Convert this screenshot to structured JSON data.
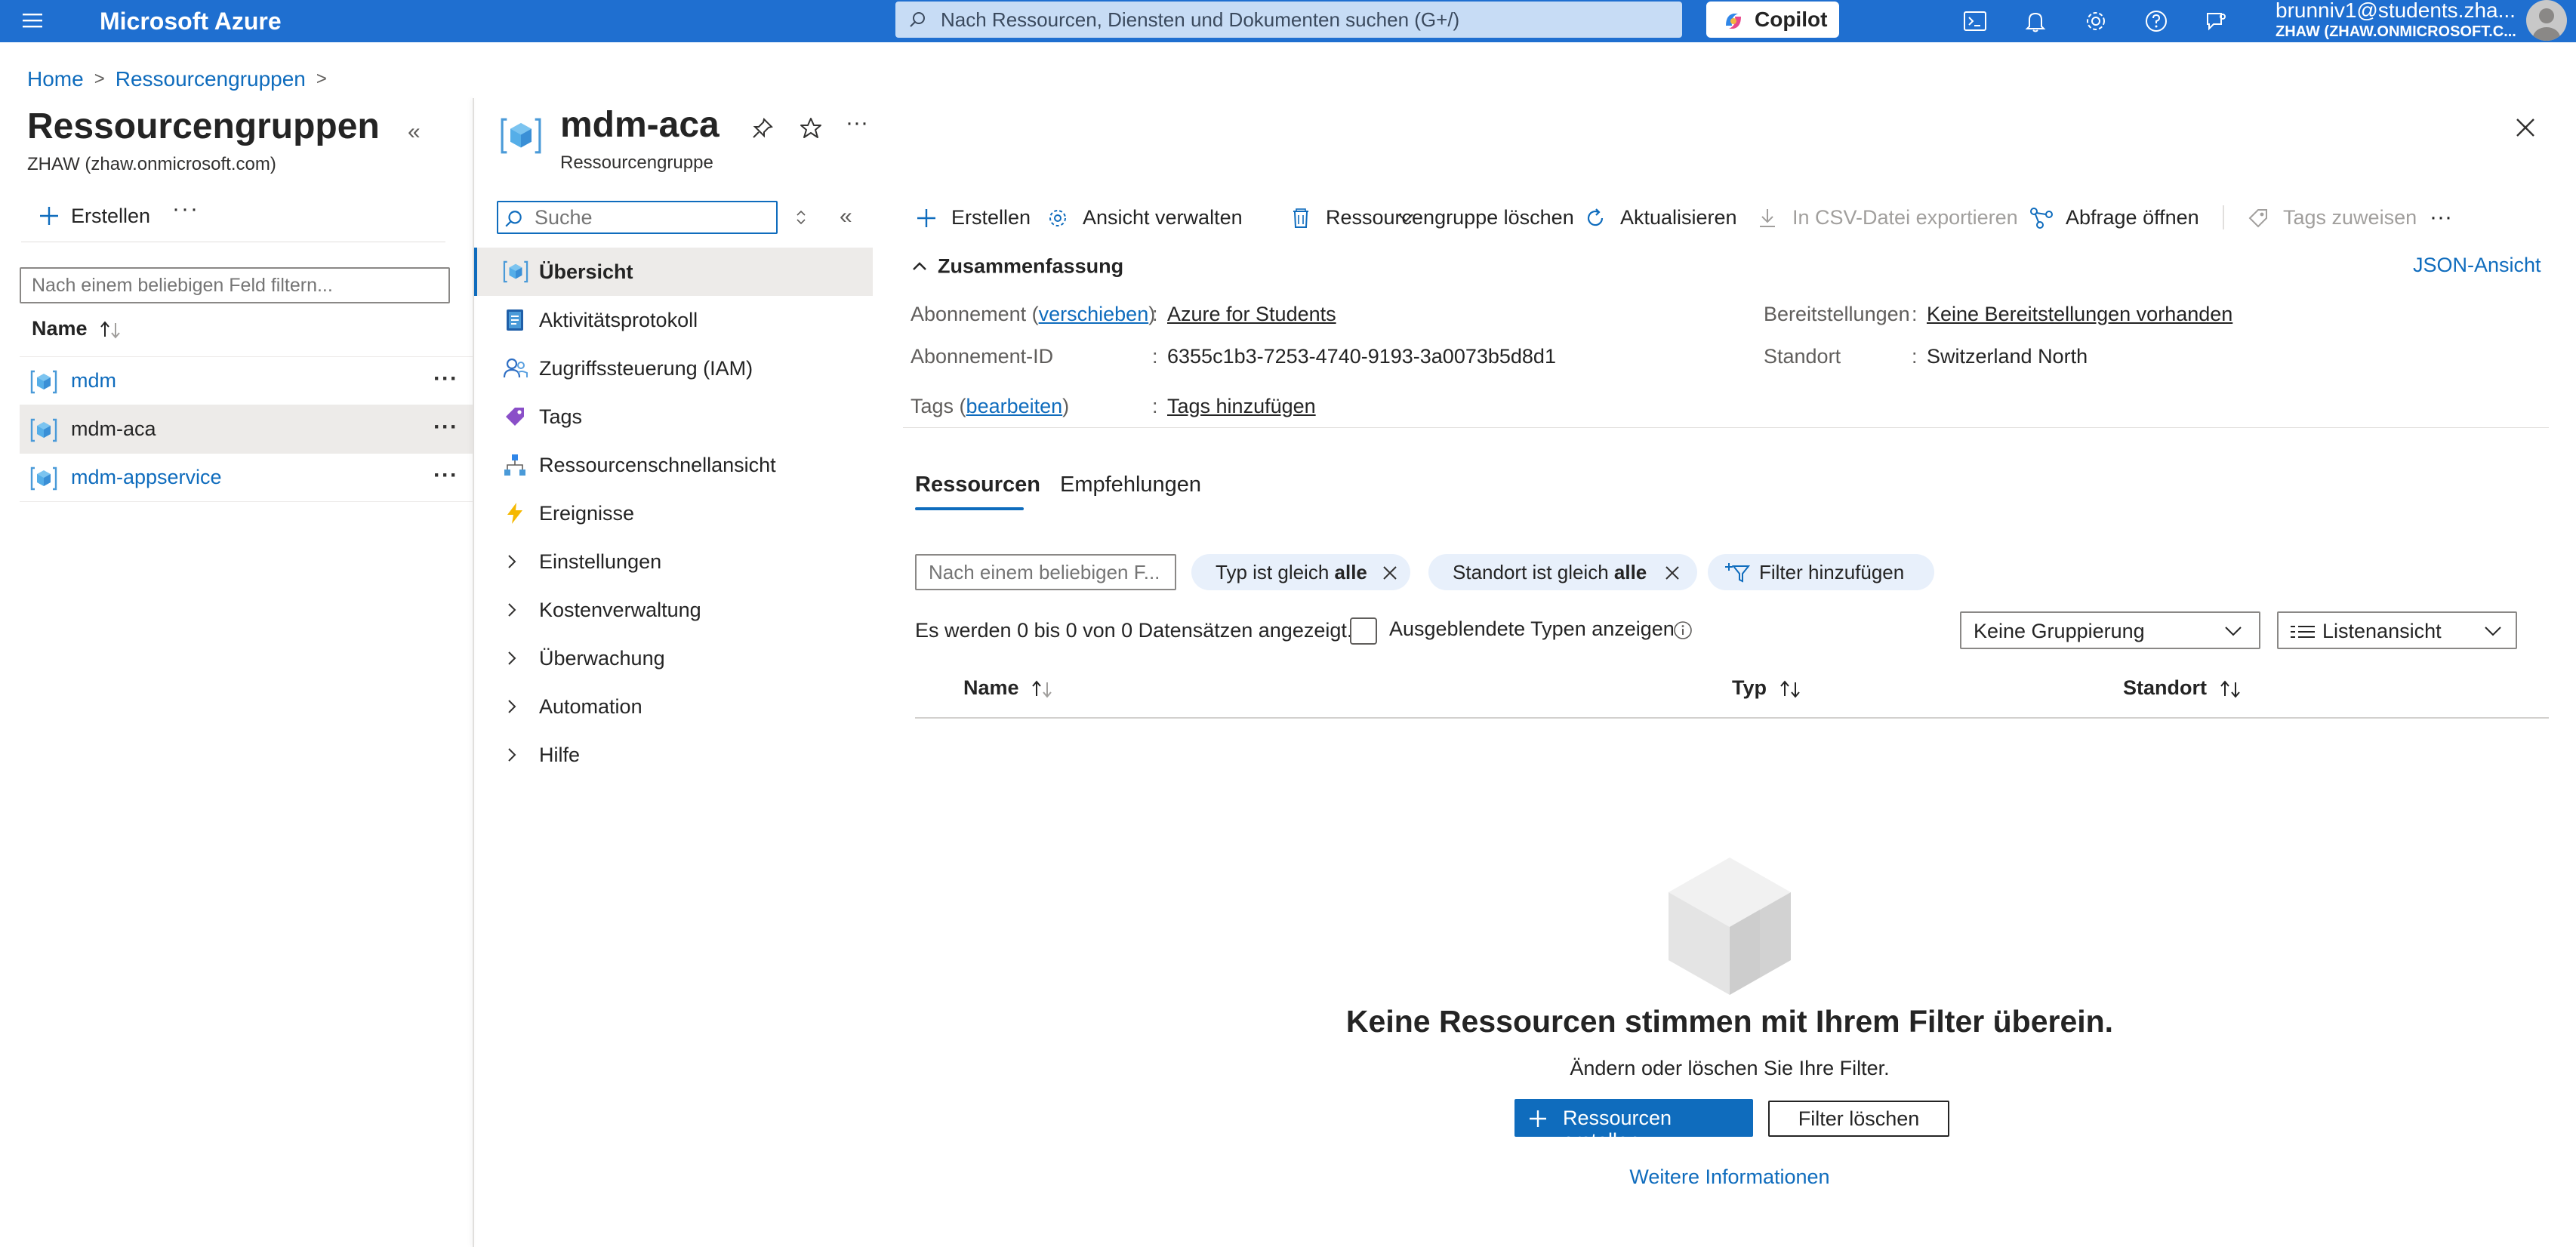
{
  "topbar": {
    "brand": "Microsoft Azure",
    "search_placeholder": "Nach Ressourcen, Diensten und Dokumenten suchen (G+/)",
    "copilot_label": "Copilot",
    "user_name": "brunniv1@students.zha...",
    "user_tenant": "ZHAW (ZHAW.ONMICROSOFT.C...",
    "icons": [
      "cloud-shell-icon",
      "bell-icon",
      "gear-icon",
      "help-icon",
      "feedback-icon"
    ]
  },
  "breadcrumb": {
    "items": [
      "Home",
      "Ressourcengruppen"
    ],
    "separator": ">"
  },
  "left_panel": {
    "title": "Ressourcengruppen",
    "subtitle": "ZHAW (zhaw.onmicrosoft.com)",
    "collapse_label": "«",
    "create_label": "Erstellen",
    "more_label": "···",
    "filter_placeholder": "Nach einem beliebigen Feld filtern...",
    "column_name": "Name",
    "rows": [
      {
        "name": "mdm",
        "selected": false
      },
      {
        "name": "mdm-aca",
        "selected": true
      },
      {
        "name": "mdm-appservice",
        "selected": false
      }
    ],
    "row_more": "···"
  },
  "resource_group": {
    "name": "mdm-aca",
    "type": "Ressourcengruppe",
    "more_label": "···"
  },
  "menu": {
    "search_placeholder": "Suche",
    "collapse_label": "«",
    "items": [
      {
        "label": "Übersicht",
        "icon": "resource-group-icon",
        "active": true
      },
      {
        "label": "Aktivitätsprotokoll",
        "icon": "activity-log-icon"
      },
      {
        "label": "Zugriffssteuerung (IAM)",
        "icon": "iam-icon"
      },
      {
        "label": "Tags",
        "icon": "tag-icon"
      },
      {
        "label": "Ressourcenschnellansicht",
        "icon": "visualizer-icon"
      },
      {
        "label": "Ereignisse",
        "icon": "lightning-icon"
      },
      {
        "label": "Einstellungen",
        "expandable": true
      },
      {
        "label": "Kostenverwaltung",
        "expandable": true
      },
      {
        "label": "Überwachung",
        "expandable": true
      },
      {
        "label": "Automation",
        "expandable": true
      },
      {
        "label": "Hilfe",
        "expandable": true
      }
    ]
  },
  "toolbar": {
    "create": "Erstellen",
    "manage_view": "Ansicht verwalten",
    "delete_rg": "Ressourcengruppe löschen",
    "refresh": "Aktualisieren",
    "export_csv": "In CSV-Datei exportieren",
    "open_query": "Abfrage öffnen",
    "assign_tags": "Tags zuweisen",
    "more": "···"
  },
  "summary": {
    "heading": "Zusammenfassung",
    "json_view": "JSON-Ansicht",
    "subscription_label": "Abonnement",
    "subscription_move": "verschieben",
    "subscription_value": "Azure for Students",
    "subscription_id_label": "Abonnement-ID",
    "subscription_id_value": "6355c1b3-7253-4740-9193-3a0073b5d8d1",
    "tags_label": "Tags",
    "tags_edit": "bearbeiten",
    "tags_value": "Tags hinzufügen",
    "deployments_label": "Bereitstellungen",
    "deployments_value": "Keine Bereitstellungen vorhanden",
    "location_label": "Standort",
    "location_value": "Switzerland North",
    "colon": ":"
  },
  "tabs": {
    "resources": "Ressourcen",
    "recommendations": "Empfehlungen"
  },
  "filters": {
    "placeholder": "Nach einem beliebigen F...",
    "type_prefix": "Typ ist gleich ",
    "type_value": "alle",
    "location_prefix": "Standort ist gleich ",
    "location_value": "alle",
    "add_filter": "Filter hinzufügen"
  },
  "list": {
    "count_text": "Es werden 0 bis 0 von 0 Datensätzen angezeigt.",
    "show_hidden_label": "Ausgeblendete Typen anzeigen",
    "grouping_value": "Keine Gruppierung",
    "view_value": "Listenansicht",
    "col_name": "Name",
    "col_type": "Typ",
    "col_location": "Standort"
  },
  "empty_state": {
    "title": "Keine Ressourcen stimmen mit Ihrem Filter überein.",
    "subtitle": "Ändern oder löschen Sie Ihre Filter.",
    "create_button": "Ressourcen erstellen",
    "clear_button": "Filter löschen",
    "more_info": "Weitere Informationen"
  },
  "colors": {
    "topbar": "#1f6fd0",
    "accent": "#0f6cbd",
    "selected_row": "#edebe9",
    "pill_bg": "#e8f0fb"
  }
}
